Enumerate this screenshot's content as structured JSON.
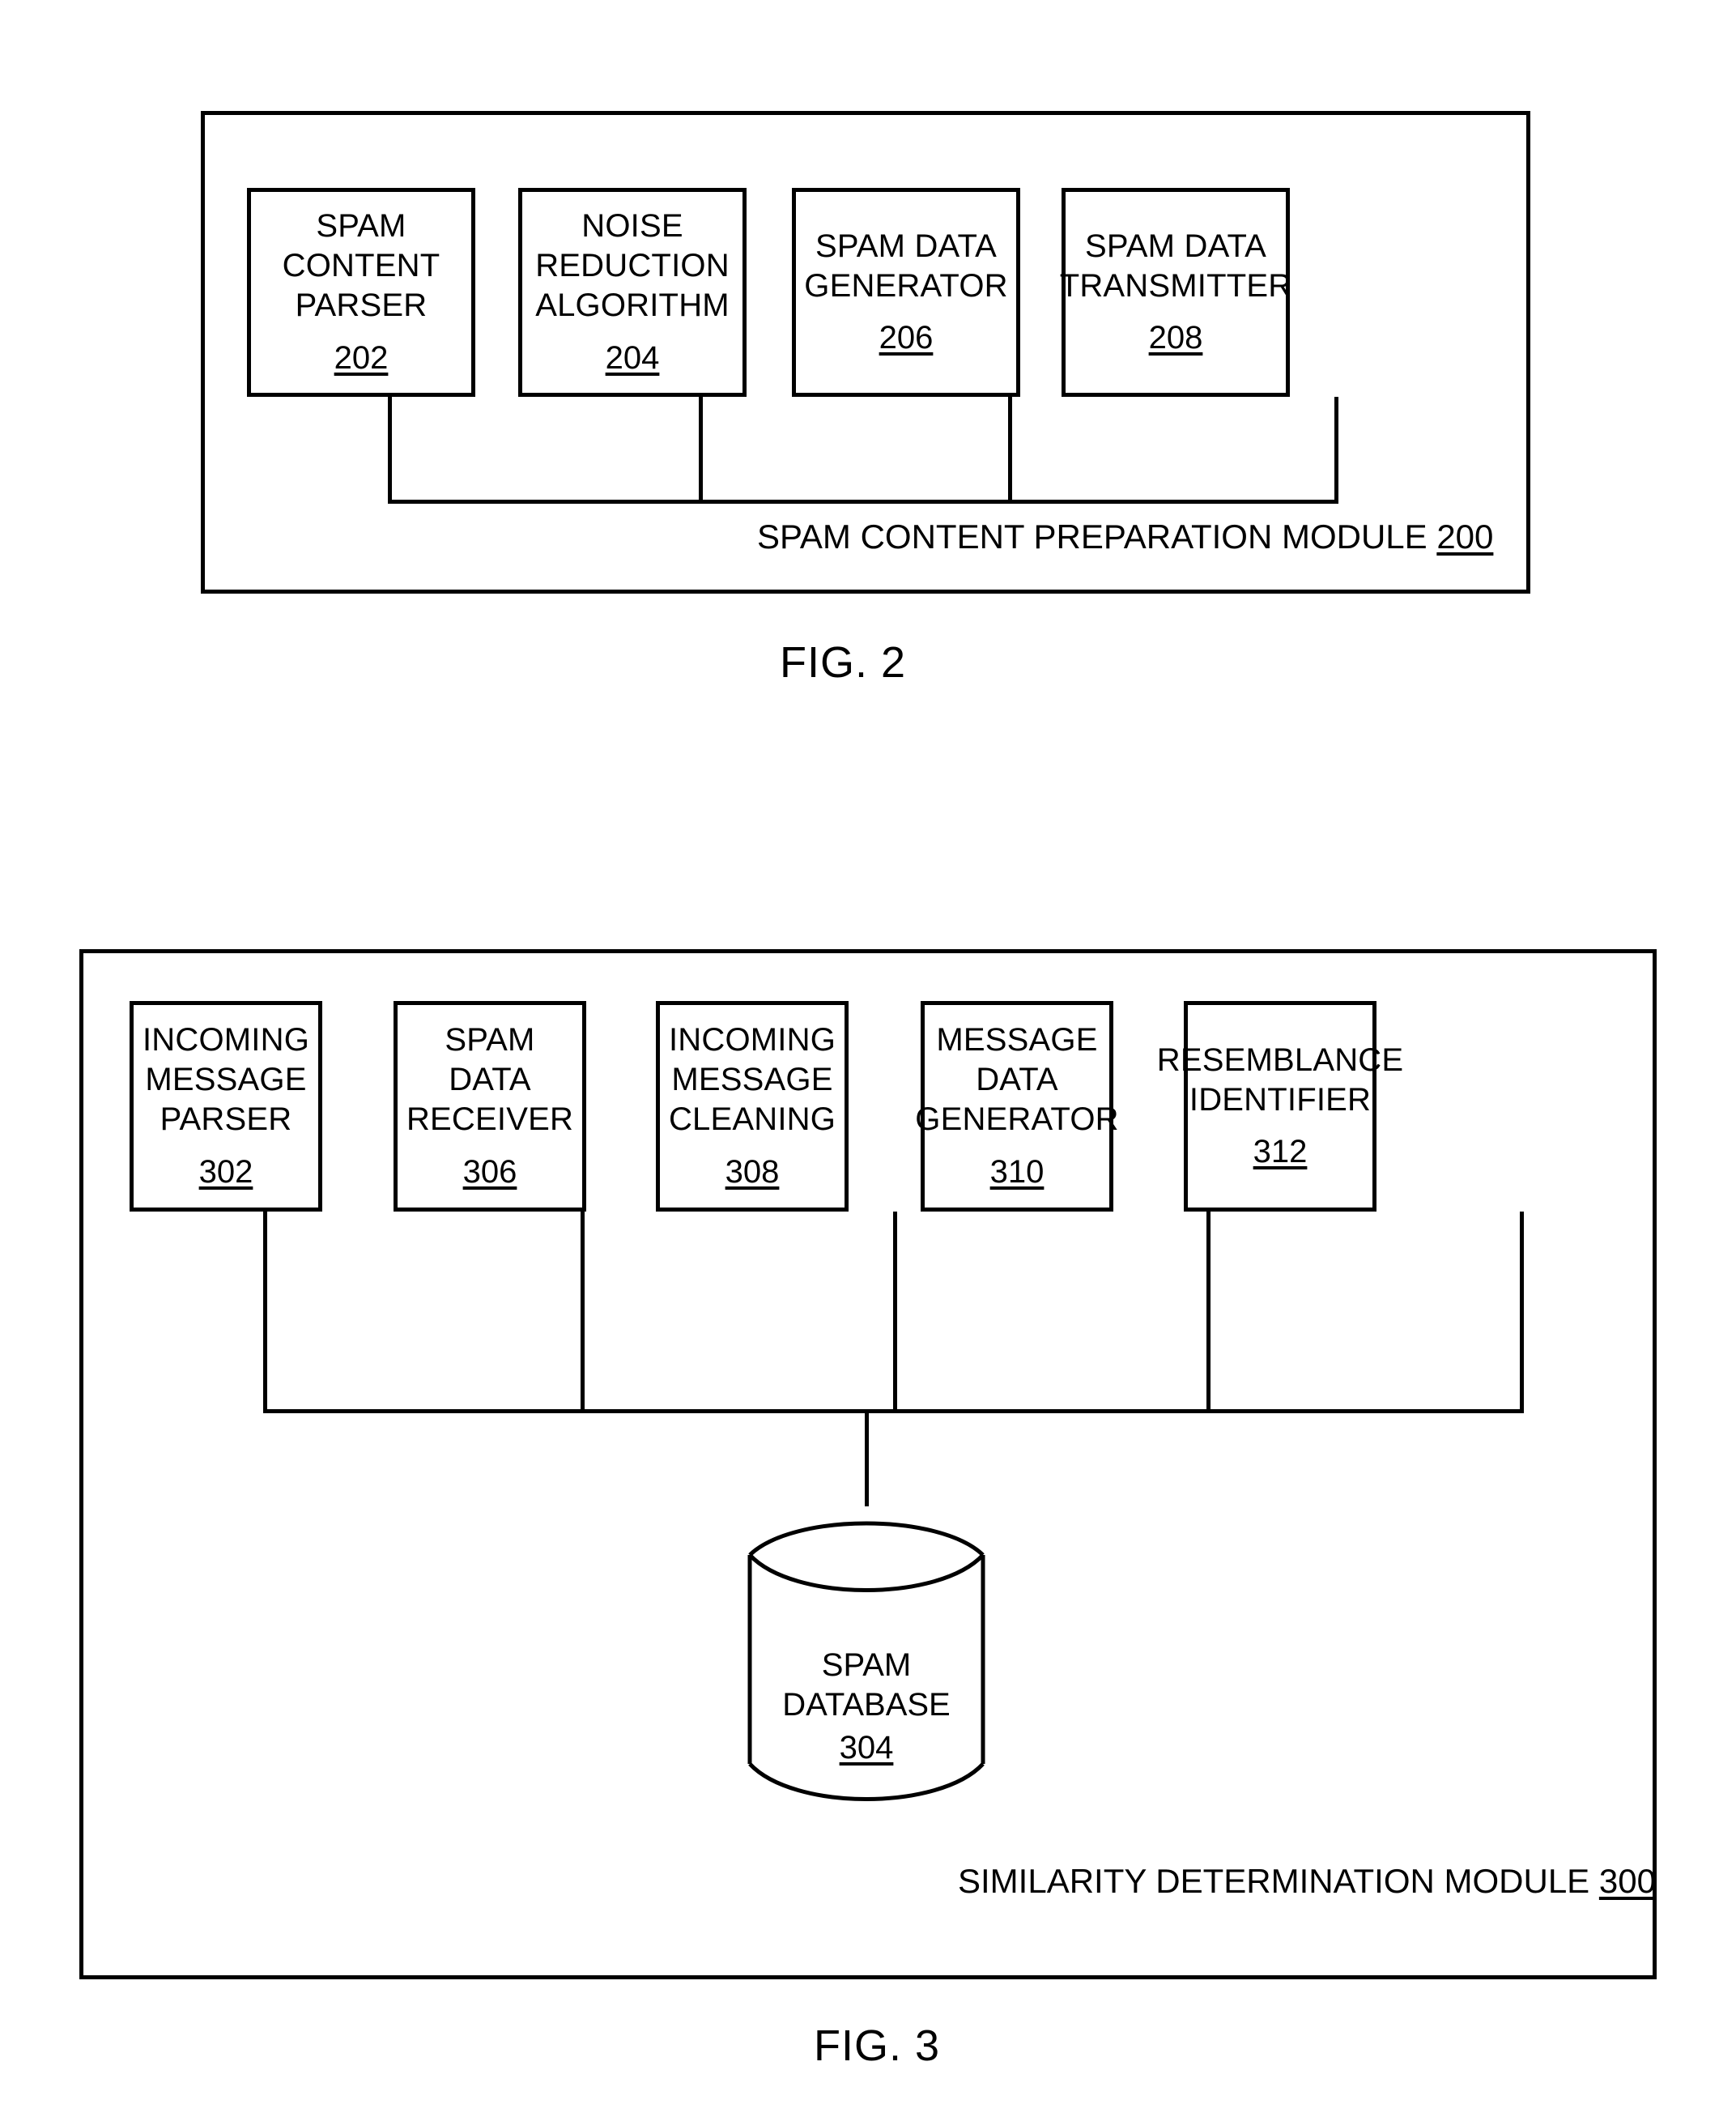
{
  "figures": [
    {
      "id": "fig2",
      "caption": "FIG. 2",
      "module": {
        "name": "SPAM CONTENT PREPARATION MODULE",
        "ref": "200"
      },
      "boxes": [
        {
          "label": "SPAM\nCONTENT\nPARSER",
          "ref": "202"
        },
        {
          "label": "NOISE\nREDUCTION\nALGORITHM",
          "ref": "204"
        },
        {
          "label": "SPAM DATA\nGENERATOR",
          "ref": "206"
        },
        {
          "label": "SPAM DATA\nTRANSMITTER",
          "ref": "208"
        }
      ]
    },
    {
      "id": "fig3",
      "caption": "FIG. 3",
      "module": {
        "name": "SIMILARITY DETERMINATION MODULE",
        "ref": "300"
      },
      "boxes": [
        {
          "label": "INCOMING\nMESSAGE\nPARSER",
          "ref": "302"
        },
        {
          "label": "SPAM DATA\nRECEIVER",
          "ref": "306"
        },
        {
          "label": "INCOMING\nMESSAGE\nCLEANING",
          "ref": "308"
        },
        {
          "label": "MESSAGE\nDATA\nGENERATOR",
          "ref": "310"
        },
        {
          "label": "RESEMBLANCE\nIDENTIFIER",
          "ref": "312"
        }
      ],
      "database": {
        "label": "SPAM\nDATABASE",
        "ref": "304"
      }
    }
  ],
  "colors": {
    "line": "#000000",
    "background": "#ffffff"
  }
}
